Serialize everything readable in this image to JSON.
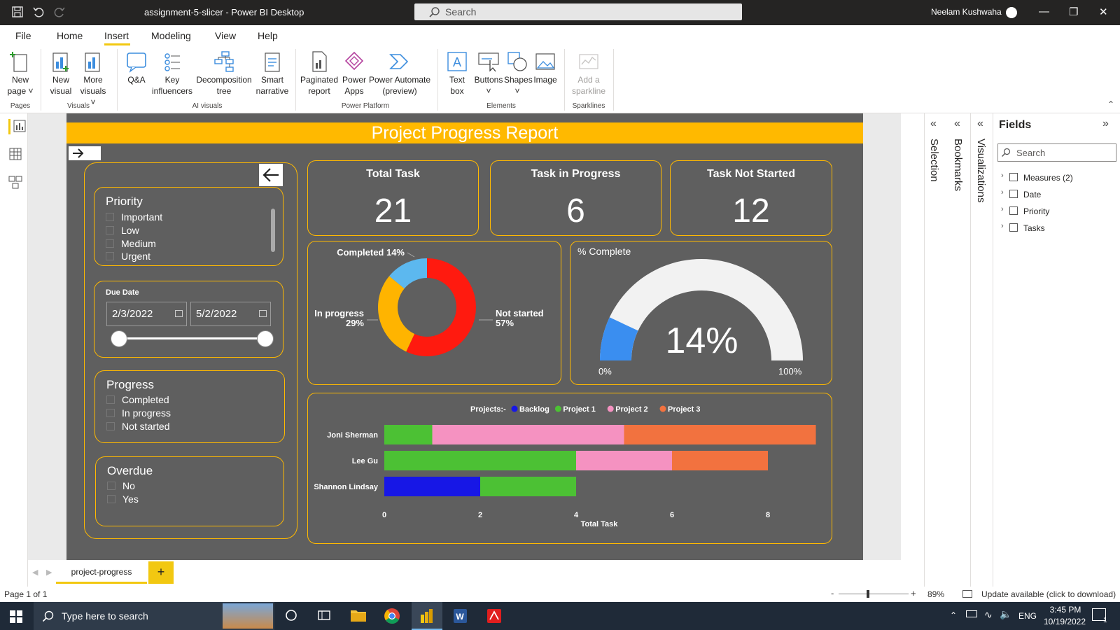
{
  "window": {
    "title": "assignment-5-slicer - Power BI Desktop",
    "search_placeholder": "Search",
    "user": "Neelam Kushwaha"
  },
  "menu": [
    "File",
    "Home",
    "Insert",
    "Modeling",
    "View",
    "Help"
  ],
  "ribbon": {
    "new_page": [
      "New",
      "page"
    ],
    "new_visual": [
      "New",
      "visual"
    ],
    "more_visuals": [
      "More",
      "visuals"
    ],
    "qa": "Q&A",
    "key_influencers": [
      "Key",
      "influencers"
    ],
    "decomposition_tree": [
      "Decomposition",
      "tree"
    ],
    "smart_narrative": [
      "Smart",
      "narrative"
    ],
    "paginated_report": [
      "Paginated",
      "report"
    ],
    "power_apps": [
      "Power",
      "Apps"
    ],
    "power_automate": [
      "Power Automate",
      "(preview)"
    ],
    "text_box": [
      "Text",
      "box"
    ],
    "buttons": "Buttons",
    "shapes": "Shapes",
    "image": "Image",
    "add_sparkline": [
      "Add a",
      "sparkline"
    ],
    "groups": {
      "pages": "Pages",
      "visuals": "Visuals",
      "ai_visuals": "AI visuals",
      "power_platform": "Power Platform",
      "elements": "Elements",
      "sparklines": "Sparklines"
    }
  },
  "report": {
    "title": "Project Progress Report",
    "priority": {
      "title": "Priority",
      "options": [
        "Important",
        "Low",
        "Medium",
        "Urgent"
      ]
    },
    "due_date": {
      "title": "Due Date",
      "start": "2/3/2022",
      "end": "5/2/2022"
    },
    "progress": {
      "title": "Progress",
      "options": [
        "Completed",
        "In progress",
        "Not started"
      ]
    },
    "overdue": {
      "title": "Overdue",
      "options": [
        "No",
        "Yes"
      ]
    },
    "kpis": [
      {
        "title": "Total Task",
        "value": "21"
      },
      {
        "title": "Task in Progress",
        "value": "6"
      },
      {
        "title": "Task Not Started",
        "value": "12"
      }
    ],
    "gauge": {
      "title": "% Complete",
      "value": "14%",
      "fraction": 0.14,
      "min_label": "0%",
      "max_label": "100%"
    }
  },
  "chart_data": [
    {
      "type": "pie",
      "donut": true,
      "slices": [
        {
          "label": "Not started",
          "value": 57,
          "text": "Not started\n57%",
          "color": "#ff1a0f"
        },
        {
          "label": "In progress",
          "value": 29,
          "text": "In progress\n29%",
          "color": "#ffb400"
        },
        {
          "label": "Completed",
          "value": 14,
          "text": "Completed 14%",
          "color": "#5cb8ef"
        }
      ]
    },
    {
      "type": "bar",
      "orientation": "horizontal",
      "stacked": true,
      "legend_title": "Projects:-",
      "categories": [
        "Joni Sherman",
        "Lee Gu",
        "Shannon Lindsay"
      ],
      "series": [
        {
          "name": "Backlog",
          "color": "#1717e6",
          "values": [
            0,
            0,
            2
          ]
        },
        {
          "name": "Project 1",
          "color": "#4cc134",
          "values": [
            1,
            4,
            2
          ]
        },
        {
          "name": "Project 2",
          "color": "#f592c1",
          "values": [
            4,
            2,
            0
          ]
        },
        {
          "name": "Project 3",
          "color": "#f2723f",
          "values": [
            4,
            2,
            0
          ]
        }
      ],
      "xlabel": "Total Task",
      "xticks": [
        "0",
        "2",
        "4",
        "6",
        "8"
      ],
      "xlim": [
        0,
        9
      ]
    }
  ],
  "panes": {
    "selection": "Selection",
    "bookmarks": "Bookmarks",
    "visualizations": "Visualizations",
    "fields_title": "Fields",
    "fields_search": "Search",
    "fields": [
      "Measures (2)",
      "Date",
      "Priority",
      "Tasks"
    ]
  },
  "page_tab": "project-progress",
  "status": {
    "page": "Page 1 of 1",
    "zoom": "89%",
    "update": "Update available (click to download)"
  },
  "taskbar": {
    "search": "Type here to search",
    "lang": "ENG",
    "time": "3:45 PM",
    "date": "10/19/2022",
    "notif": "1"
  }
}
